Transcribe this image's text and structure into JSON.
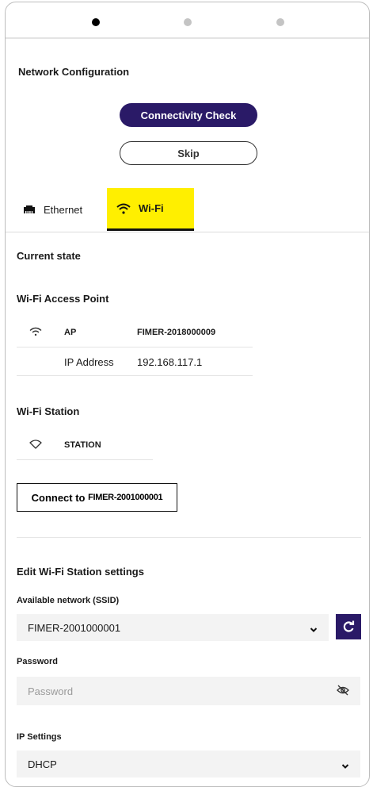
{
  "stepper": {
    "steps": 3,
    "active_step": 1
  },
  "page": {
    "title": "Network Configuration"
  },
  "actions": {
    "connectivity_check_label": "Connectivity Check",
    "skip_label": "Skip"
  },
  "tabs": {
    "ethernet_label": "Ethernet",
    "wifi_label": "Wi-Fi",
    "active": "wifi"
  },
  "current_state": {
    "heading": "Current state"
  },
  "access_point": {
    "heading": "Wi-Fi Access Point",
    "ap_key": "AP",
    "ap_value": "FIMER-2018000009",
    "ip_key": "IP Address",
    "ip_value": "192.168.117.1"
  },
  "station": {
    "heading": "Wi-Fi Station",
    "station_key": "STATION",
    "connect_prefix": "Connect to ",
    "connect_ssid": "FIMER-2001000001"
  },
  "edit_settings": {
    "heading": "Edit Wi-Fi Station settings",
    "ssid_label": "Available network (SSID)",
    "ssid_value": "FIMER-2001000001",
    "password_label": "Password",
    "password_placeholder": "Password",
    "ip_settings_label": "IP Settings",
    "ip_settings_value": "DHCP"
  },
  "colors": {
    "primary": "#2a1a67",
    "tab_highlight": "#ffef00",
    "field_bg": "#f3f3f3"
  },
  "icons": [
    "ethernet-icon",
    "wifi-icon",
    "chevron-down-icon",
    "refresh-icon",
    "eye-off-icon"
  ]
}
